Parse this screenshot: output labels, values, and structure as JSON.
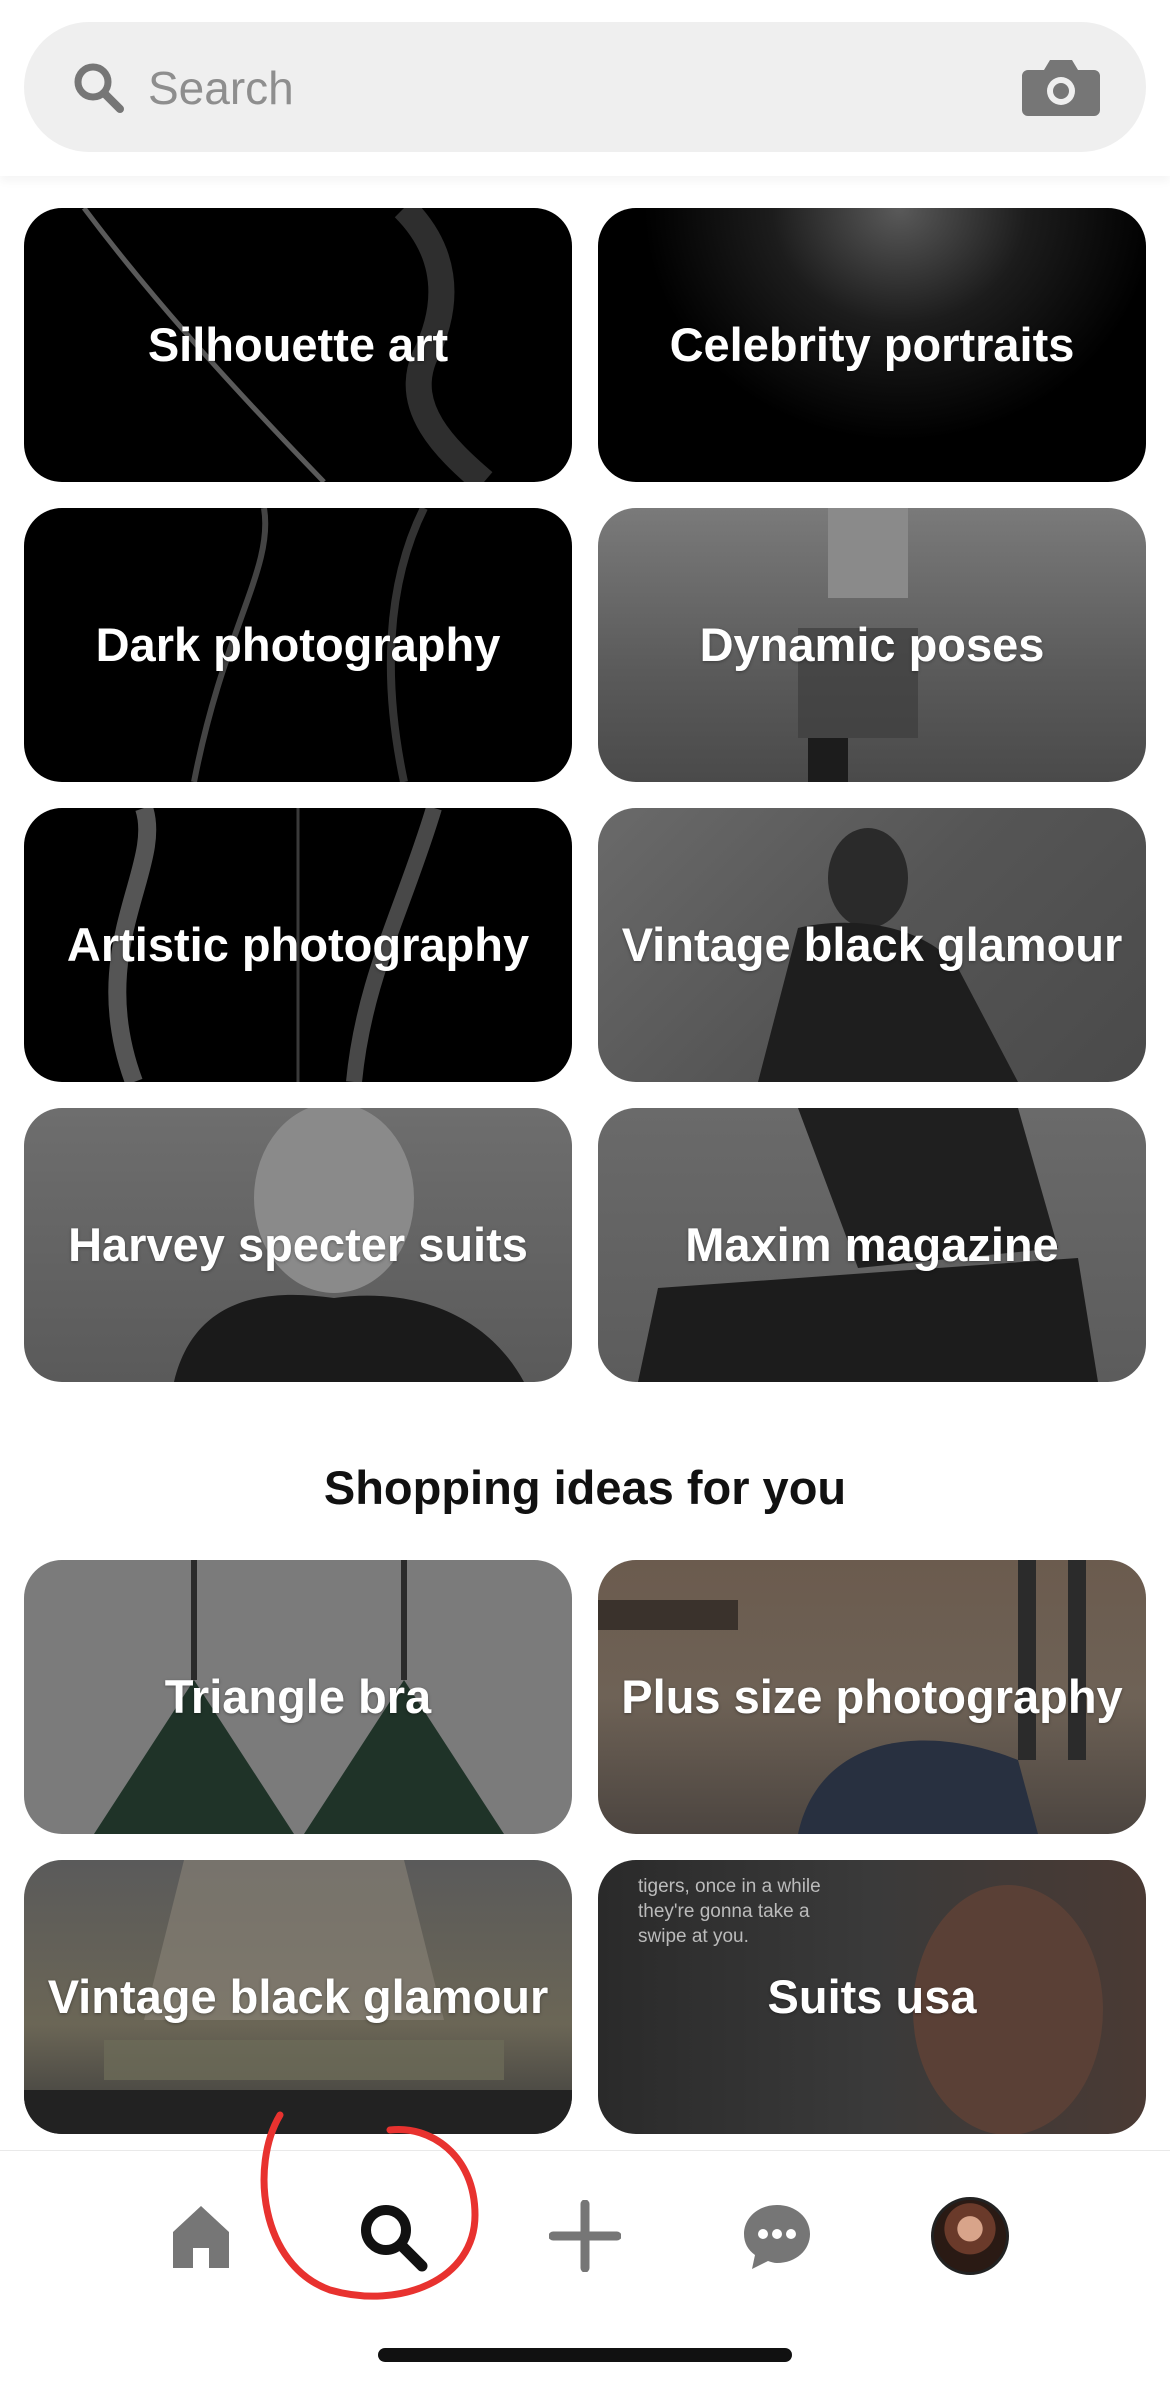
{
  "search": {
    "placeholder": "Search",
    "icon": "search-icon",
    "camera_icon": "camera-icon"
  },
  "ideas": [
    {
      "label": "Silhouette art"
    },
    {
      "label": "Celebrity portraits"
    },
    {
      "label": "Dark photography"
    },
    {
      "label": "Dynamic poses"
    },
    {
      "label": "Artistic photography"
    },
    {
      "label": "Vintage black glamour"
    },
    {
      "label": "Harvey specter suits"
    },
    {
      "label": "Maxim magazine"
    }
  ],
  "shopping": {
    "title": "Shopping ideas for you",
    "items": [
      {
        "label": "Triangle bra"
      },
      {
        "label": "Plus size photography"
      },
      {
        "label": "Vintage black glamour"
      },
      {
        "label": "Suits usa"
      }
    ],
    "quote_snippet": "tigers, once in a while they're gonna take a swipe at you."
  },
  "nav": {
    "items": [
      "home-icon",
      "search-icon",
      "plus-icon",
      "messages-icon",
      "profile-avatar"
    ],
    "active": "search-icon"
  },
  "colors": {
    "annotation": "#e8322f",
    "icon_gray": "#767676",
    "active_icon": "#111111"
  }
}
